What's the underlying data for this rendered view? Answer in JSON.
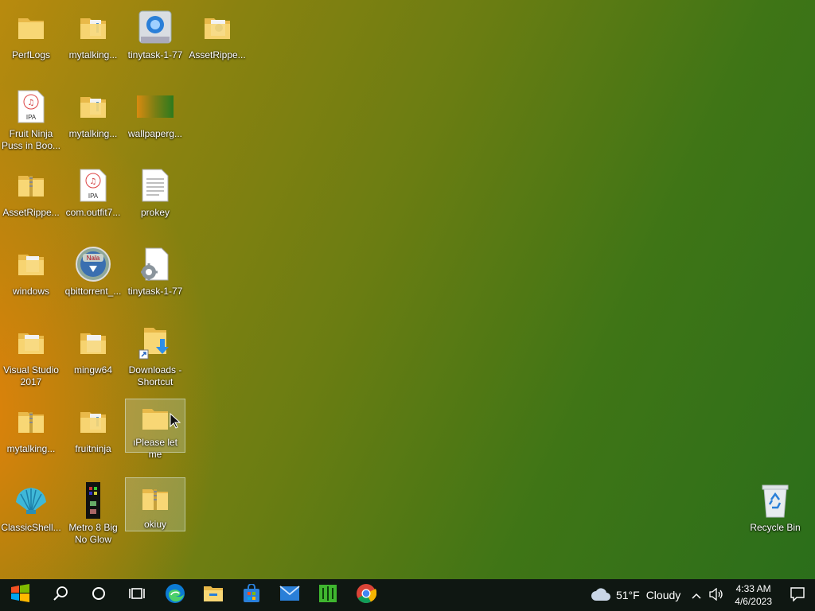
{
  "desktop": {
    "icons": [
      {
        "id": "perflogs",
        "label": "PerfLogs",
        "type": "folder"
      },
      {
        "id": "mytalking1",
        "label": "mytalking...",
        "type": "folder"
      },
      {
        "id": "tinytask1",
        "label": "tinytask-1-77",
        "type": "app"
      },
      {
        "id": "assetripper1",
        "label": "AssetRippe...",
        "type": "folder"
      },
      {
        "id": "fruitninja",
        "label": "Fruit Ninja Puss in Boo...",
        "type": "ipa"
      },
      {
        "id": "mytalking2",
        "label": "mytalking...",
        "type": "folder"
      },
      {
        "id": "wallpaper",
        "label": "wallpaperg...",
        "type": "image"
      },
      {
        "id": "assetripper2",
        "label": "AssetRippe...",
        "type": "zip"
      },
      {
        "id": "comoutfit",
        "label": "com.outfit7...",
        "type": "ipa"
      },
      {
        "id": "prokey",
        "label": "prokey",
        "type": "text"
      },
      {
        "id": "windows",
        "label": "windows",
        "type": "folder"
      },
      {
        "id": "qbittorrent",
        "label": "qbittorrent_...",
        "type": "installer"
      },
      {
        "id": "tinytask2",
        "label": "tinytask-1-77",
        "type": "config"
      },
      {
        "id": "visualstudio",
        "label": "Visual Studio 2017",
        "type": "folder"
      },
      {
        "id": "mingw64",
        "label": "mingw64",
        "type": "folder"
      },
      {
        "id": "downloads",
        "label": "Downloads - Shortcut",
        "type": "shortcut"
      },
      {
        "id": "mytalking3",
        "label": "mytalking...",
        "type": "zip"
      },
      {
        "id": "fruitninja2",
        "label": "fruitninja",
        "type": "folder"
      },
      {
        "id": "pleaseletme",
        "label": "ıPlease let me",
        "type": "folder"
      },
      {
        "id": "classicshell",
        "label": "ClassicShell...",
        "type": "shell"
      },
      {
        "id": "metro8",
        "label": "Metro 8 Big No Glow",
        "type": "theme"
      },
      {
        "id": "okiuy",
        "label": "okiuy",
        "type": "zip"
      },
      {
        "id": "recyclebin",
        "label": "Recycle Bin",
        "type": "recycle"
      }
    ]
  },
  "taskbar": {
    "buttons": [
      "start",
      "search",
      "cortana",
      "task-view",
      "edge",
      "file-explorer",
      "store",
      "mail",
      "app-green",
      "chrome"
    ],
    "weather": {
      "temp": "51°F",
      "condition": "Cloudy"
    },
    "clock": {
      "time": "4:33 AM",
      "date": "4/6/2023"
    }
  }
}
